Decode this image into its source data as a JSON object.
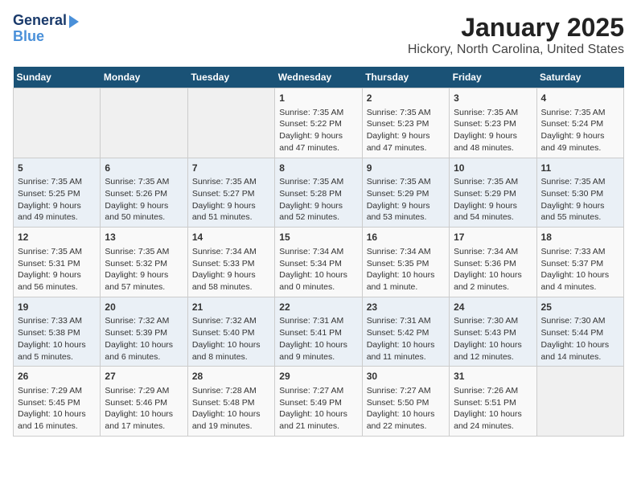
{
  "logo": {
    "line1": "General",
    "line2": "Blue"
  },
  "title": "January 2025",
  "location": "Hickory, North Carolina, United States",
  "weekdays": [
    "Sunday",
    "Monday",
    "Tuesday",
    "Wednesday",
    "Thursday",
    "Friday",
    "Saturday"
  ],
  "weeks": [
    [
      {
        "day": "",
        "sunrise": "",
        "sunset": "",
        "daylight": ""
      },
      {
        "day": "",
        "sunrise": "",
        "sunset": "",
        "daylight": ""
      },
      {
        "day": "",
        "sunrise": "",
        "sunset": "",
        "daylight": ""
      },
      {
        "day": "1",
        "sunrise": "Sunrise: 7:35 AM",
        "sunset": "Sunset: 5:22 PM",
        "daylight": "Daylight: 9 hours and 47 minutes."
      },
      {
        "day": "2",
        "sunrise": "Sunrise: 7:35 AM",
        "sunset": "Sunset: 5:23 PM",
        "daylight": "Daylight: 9 hours and 47 minutes."
      },
      {
        "day": "3",
        "sunrise": "Sunrise: 7:35 AM",
        "sunset": "Sunset: 5:23 PM",
        "daylight": "Daylight: 9 hours and 48 minutes."
      },
      {
        "day": "4",
        "sunrise": "Sunrise: 7:35 AM",
        "sunset": "Sunset: 5:24 PM",
        "daylight": "Daylight: 9 hours and 49 minutes."
      }
    ],
    [
      {
        "day": "5",
        "sunrise": "Sunrise: 7:35 AM",
        "sunset": "Sunset: 5:25 PM",
        "daylight": "Daylight: 9 hours and 49 minutes."
      },
      {
        "day": "6",
        "sunrise": "Sunrise: 7:35 AM",
        "sunset": "Sunset: 5:26 PM",
        "daylight": "Daylight: 9 hours and 50 minutes."
      },
      {
        "day": "7",
        "sunrise": "Sunrise: 7:35 AM",
        "sunset": "Sunset: 5:27 PM",
        "daylight": "Daylight: 9 hours and 51 minutes."
      },
      {
        "day": "8",
        "sunrise": "Sunrise: 7:35 AM",
        "sunset": "Sunset: 5:28 PM",
        "daylight": "Daylight: 9 hours and 52 minutes."
      },
      {
        "day": "9",
        "sunrise": "Sunrise: 7:35 AM",
        "sunset": "Sunset: 5:29 PM",
        "daylight": "Daylight: 9 hours and 53 minutes."
      },
      {
        "day": "10",
        "sunrise": "Sunrise: 7:35 AM",
        "sunset": "Sunset: 5:29 PM",
        "daylight": "Daylight: 9 hours and 54 minutes."
      },
      {
        "day": "11",
        "sunrise": "Sunrise: 7:35 AM",
        "sunset": "Sunset: 5:30 PM",
        "daylight": "Daylight: 9 hours and 55 minutes."
      }
    ],
    [
      {
        "day": "12",
        "sunrise": "Sunrise: 7:35 AM",
        "sunset": "Sunset: 5:31 PM",
        "daylight": "Daylight: 9 hours and 56 minutes."
      },
      {
        "day": "13",
        "sunrise": "Sunrise: 7:35 AM",
        "sunset": "Sunset: 5:32 PM",
        "daylight": "Daylight: 9 hours and 57 minutes."
      },
      {
        "day": "14",
        "sunrise": "Sunrise: 7:34 AM",
        "sunset": "Sunset: 5:33 PM",
        "daylight": "Daylight: 9 hours and 58 minutes."
      },
      {
        "day": "15",
        "sunrise": "Sunrise: 7:34 AM",
        "sunset": "Sunset: 5:34 PM",
        "daylight": "Daylight: 10 hours and 0 minutes."
      },
      {
        "day": "16",
        "sunrise": "Sunrise: 7:34 AM",
        "sunset": "Sunset: 5:35 PM",
        "daylight": "Daylight: 10 hours and 1 minute."
      },
      {
        "day": "17",
        "sunrise": "Sunrise: 7:34 AM",
        "sunset": "Sunset: 5:36 PM",
        "daylight": "Daylight: 10 hours and 2 minutes."
      },
      {
        "day": "18",
        "sunrise": "Sunrise: 7:33 AM",
        "sunset": "Sunset: 5:37 PM",
        "daylight": "Daylight: 10 hours and 4 minutes."
      }
    ],
    [
      {
        "day": "19",
        "sunrise": "Sunrise: 7:33 AM",
        "sunset": "Sunset: 5:38 PM",
        "daylight": "Daylight: 10 hours and 5 minutes."
      },
      {
        "day": "20",
        "sunrise": "Sunrise: 7:32 AM",
        "sunset": "Sunset: 5:39 PM",
        "daylight": "Daylight: 10 hours and 6 minutes."
      },
      {
        "day": "21",
        "sunrise": "Sunrise: 7:32 AM",
        "sunset": "Sunset: 5:40 PM",
        "daylight": "Daylight: 10 hours and 8 minutes."
      },
      {
        "day": "22",
        "sunrise": "Sunrise: 7:31 AM",
        "sunset": "Sunset: 5:41 PM",
        "daylight": "Daylight: 10 hours and 9 minutes."
      },
      {
        "day": "23",
        "sunrise": "Sunrise: 7:31 AM",
        "sunset": "Sunset: 5:42 PM",
        "daylight": "Daylight: 10 hours and 11 minutes."
      },
      {
        "day": "24",
        "sunrise": "Sunrise: 7:30 AM",
        "sunset": "Sunset: 5:43 PM",
        "daylight": "Daylight: 10 hours and 12 minutes."
      },
      {
        "day": "25",
        "sunrise": "Sunrise: 7:30 AM",
        "sunset": "Sunset: 5:44 PM",
        "daylight": "Daylight: 10 hours and 14 minutes."
      }
    ],
    [
      {
        "day": "26",
        "sunrise": "Sunrise: 7:29 AM",
        "sunset": "Sunset: 5:45 PM",
        "daylight": "Daylight: 10 hours and 16 minutes."
      },
      {
        "day": "27",
        "sunrise": "Sunrise: 7:29 AM",
        "sunset": "Sunset: 5:46 PM",
        "daylight": "Daylight: 10 hours and 17 minutes."
      },
      {
        "day": "28",
        "sunrise": "Sunrise: 7:28 AM",
        "sunset": "Sunset: 5:48 PM",
        "daylight": "Daylight: 10 hours and 19 minutes."
      },
      {
        "day": "29",
        "sunrise": "Sunrise: 7:27 AM",
        "sunset": "Sunset: 5:49 PM",
        "daylight": "Daylight: 10 hours and 21 minutes."
      },
      {
        "day": "30",
        "sunrise": "Sunrise: 7:27 AM",
        "sunset": "Sunset: 5:50 PM",
        "daylight": "Daylight: 10 hours and 22 minutes."
      },
      {
        "day": "31",
        "sunrise": "Sunrise: 7:26 AM",
        "sunset": "Sunset: 5:51 PM",
        "daylight": "Daylight: 10 hours and 24 minutes."
      },
      {
        "day": "",
        "sunrise": "",
        "sunset": "",
        "daylight": ""
      }
    ]
  ]
}
